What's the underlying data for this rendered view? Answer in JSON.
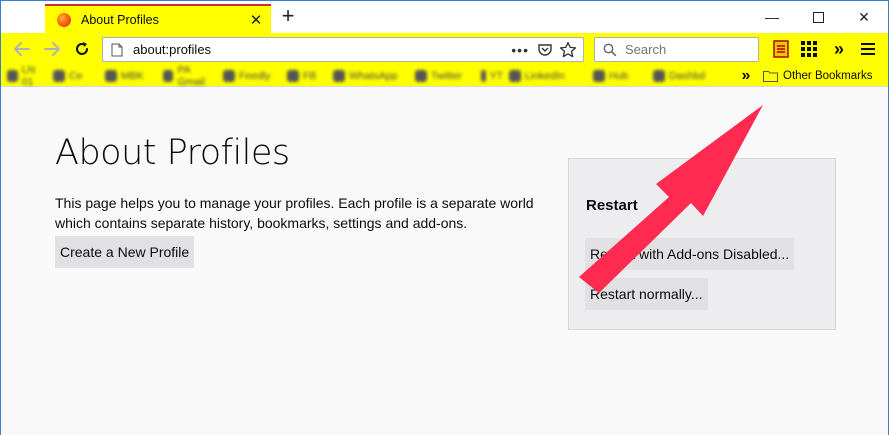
{
  "browser": {
    "tab": {
      "title": "About Profiles",
      "close_glyph": "✕"
    },
    "new_tab_glyph": "+",
    "window_controls": {
      "minimize": "—",
      "close": "✕"
    },
    "url": "about:profiles",
    "url_dots": "•••",
    "search_placeholder": "Search",
    "toolbar_overflow": "»",
    "bookmarks": [
      {
        "label": "LN 01",
        "blurred": true
      },
      {
        "label": "Ce",
        "blurred": true
      },
      {
        "label": "MBK",
        "blurred": true
      },
      {
        "label": "PA Gmail",
        "blurred": true
      },
      {
        "label": "Feedly",
        "blurred": true
      },
      {
        "label": "FB",
        "blurred": true
      },
      {
        "label": "WhatsApp",
        "blurred": true
      },
      {
        "label": "Twitter",
        "blurred": true
      },
      {
        "label": "YT",
        "blurred": true
      },
      {
        "label": "LinkedIn",
        "blurred": true
      },
      {
        "label": "Hub",
        "blurred": true
      },
      {
        "label": "Dashbd",
        "blurred": true
      }
    ],
    "bookmarks_overflow": "»",
    "other_bookmarks": "Other Bookmarks"
  },
  "page": {
    "title": "About Profiles",
    "description": "This page helps you to manage your profiles. Each profile is a separate world which contains separate history, bookmarks, settings and add-ons.",
    "create_button": "Create a New Profile",
    "restart": {
      "heading": "Restart",
      "addons_disabled_button": "Restart with Add-ons Disabled...",
      "normally_button": "Restart normally..."
    }
  },
  "colors": {
    "toolbar_highlight": "#ffff00",
    "tab_top_line": "#cc2f2f",
    "arrow": "#ff2a50",
    "window_border": "#3d7cc9"
  },
  "annotation": {
    "type": "arrow",
    "icon": "red-pointer-arrow"
  }
}
